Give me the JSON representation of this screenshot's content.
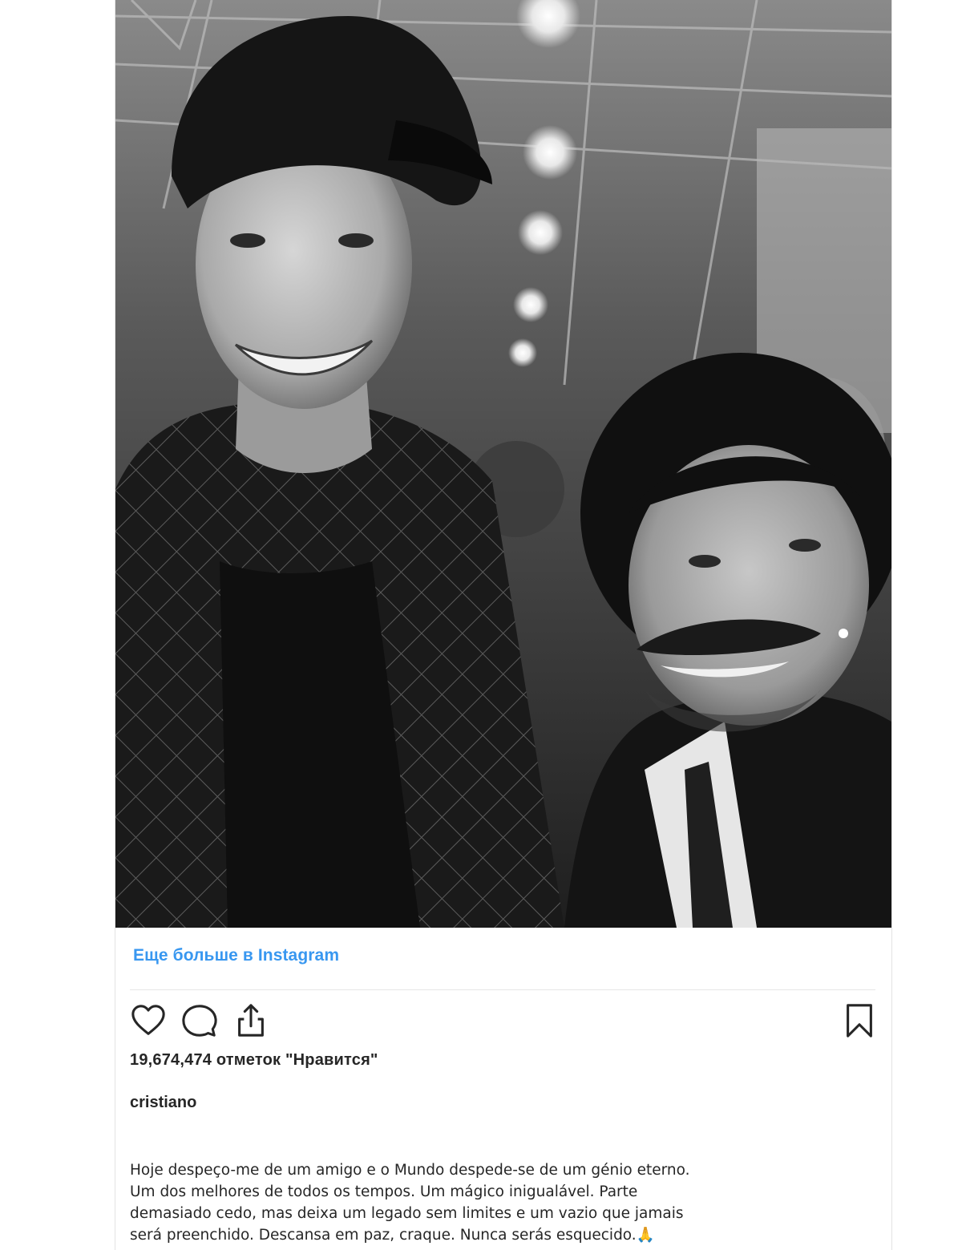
{
  "post": {
    "photo_alt": "Black and white selfie of two men in a crowded indoor venue: a young man in a black cap and quilted jacket, and an older man with curly hair and a mustache in a suit and tie",
    "view_more_label": "Еще больше в Instagram",
    "likes_count": "19,674,474",
    "likes_suffix": "отметок \"Нравится\"",
    "username": "cristiano",
    "caption_text": "Hoje despeço-me de um amigo e o Mundo despede-se de um génio eterno.\nUm dos melhores de todos os tempos. Um mágico inigualável. Parte\ndemasiado cedo, mas deixa um legado sem limites e um vazio que jamais\nserá preenchido. Descansa em paz, craque. Nunca serás esquecido.",
    "caption_emoji": "🙏"
  },
  "icons": {
    "like": "heart-icon",
    "comment": "speech-bubble-icon",
    "share": "share-arrow-icon",
    "save": "bookmark-icon"
  },
  "colors": {
    "link": "#3897f0",
    "text": "#262626",
    "divider": "#e6e6e6"
  }
}
